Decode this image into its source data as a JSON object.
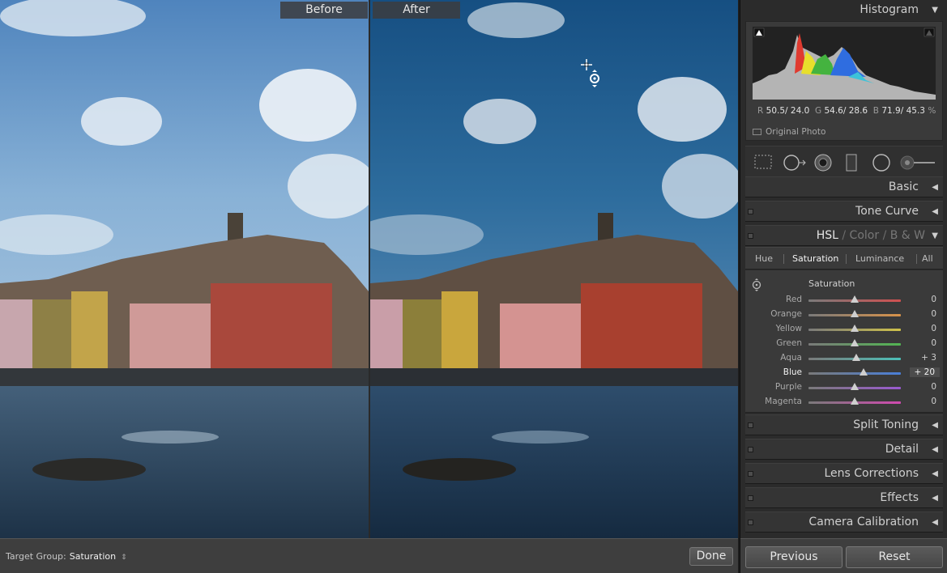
{
  "viewer": {
    "before_label": "Before",
    "after_label": "After"
  },
  "toolbar": {
    "target_group_label": "Target Group:",
    "target_group_value": "Saturation",
    "done_label": "Done"
  },
  "panel": {
    "histogram": {
      "title": "Histogram",
      "r_label": "R",
      "r_value": "50.5/ 24.0",
      "g_label": "G",
      "g_value": "54.6/ 28.6",
      "b_label": "B",
      "b_value": "71.9/ 45.3",
      "percent": "%",
      "original_photo_label": "Original Photo"
    },
    "sections": {
      "basic": "Basic",
      "tone_curve": "Tone Curve",
      "split_toning": "Split Toning",
      "detail": "Detail",
      "lens_corrections": "Lens Corrections",
      "effects": "Effects",
      "camera_calibration": "Camera Calibration"
    },
    "hsl_header": {
      "hsl": "HSL",
      "sep1": "/",
      "color": "Color",
      "sep2": "/",
      "bw": "B & W"
    },
    "hsl_tabs": [
      "Hue",
      "Saturation",
      "Luminance",
      "All"
    ],
    "active_tab": "Saturation",
    "saturation_heading": "Saturation",
    "sliders": [
      {
        "label": "Red",
        "value": "0",
        "num": 0,
        "color": "#d05050"
      },
      {
        "label": "Orange",
        "value": "0",
        "num": 0,
        "color": "#d8924a"
      },
      {
        "label": "Yellow",
        "value": "0",
        "num": 0,
        "color": "#cfc24a"
      },
      {
        "label": "Green",
        "value": "0",
        "num": 0,
        "color": "#52b552"
      },
      {
        "label": "Aqua",
        "value": "+ 3",
        "num": 3,
        "color": "#4cc0b8"
      },
      {
        "label": "Blue",
        "value": "+ 20",
        "num": 20,
        "color": "#4a7fd8"
      },
      {
        "label": "Purple",
        "value": "0",
        "num": 0,
        "color": "#9a5ad0"
      },
      {
        "label": "Magenta",
        "value": "0",
        "num": 0,
        "color": "#d04ab0"
      }
    ],
    "buttons": {
      "previous": "Previous",
      "reset": "Reset"
    }
  },
  "colors": {
    "accent_blue": "#1a5f8f"
  }
}
